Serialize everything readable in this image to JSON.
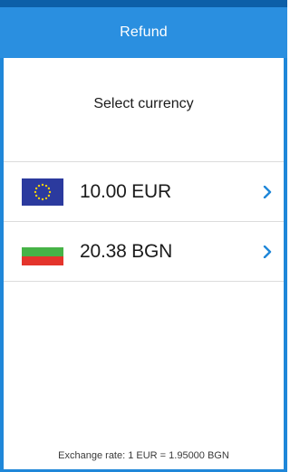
{
  "header": {
    "title": "Refund"
  },
  "subtitle": "Select currency",
  "currencies": [
    {
      "amount": "10.00 EUR",
      "flag": "eu-flag-icon"
    },
    {
      "amount": "20.38 BGN",
      "flag": "bulgaria-flag-icon"
    }
  ],
  "footer": {
    "exchange_rate": "Exchange rate: 1 EUR = 1.95000 BGN"
  },
  "colors": {
    "accent": "#2a8fe0",
    "chevron": "#1f87d9",
    "eu_blue": "#2b3a9e",
    "eu_star": "#f5d10a",
    "bg_white": "#ffffff",
    "bg_green": "#46b347",
    "bg_red": "#e4342c"
  }
}
